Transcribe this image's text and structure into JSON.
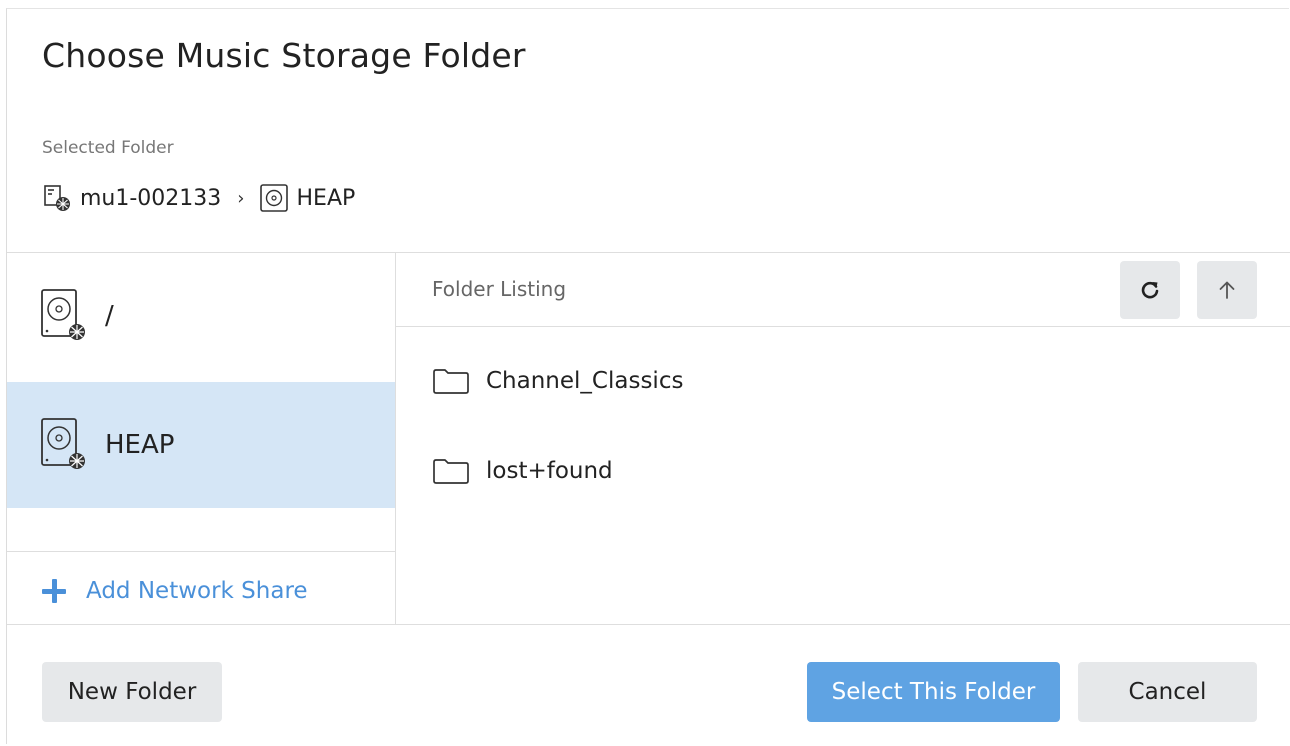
{
  "dialog": {
    "title": "Choose Music Storage Folder"
  },
  "selected": {
    "label": "Selected Folder",
    "breadcrumb": [
      {
        "label": "mu1-002133",
        "icon": "network-server-icon"
      },
      {
        "label": "HEAP",
        "icon": "drive-icon"
      }
    ],
    "separator": "›"
  },
  "volumes": [
    {
      "label": "/",
      "icon": "hard-drive-icon",
      "selected": false
    },
    {
      "label": "HEAP",
      "icon": "hard-drive-icon",
      "selected": true
    }
  ],
  "add_share": {
    "label": "Add Network Share",
    "icon": "plus-icon"
  },
  "listing": {
    "title": "Folder Listing",
    "refresh_icon": "refresh-icon",
    "up_icon": "arrow-up-icon",
    "folders": [
      {
        "name": "Channel_Classics",
        "icon": "folder-icon"
      },
      {
        "name": "lost+found",
        "icon": "folder-icon"
      }
    ]
  },
  "buttons": {
    "new_folder": "New Folder",
    "select": "Select This Folder",
    "cancel": "Cancel"
  },
  "colors": {
    "accent": "#5fa3e3",
    "link": "#4a90d9",
    "selected_row": "#d5e6f6",
    "button_gray": "#e6e8ea"
  }
}
